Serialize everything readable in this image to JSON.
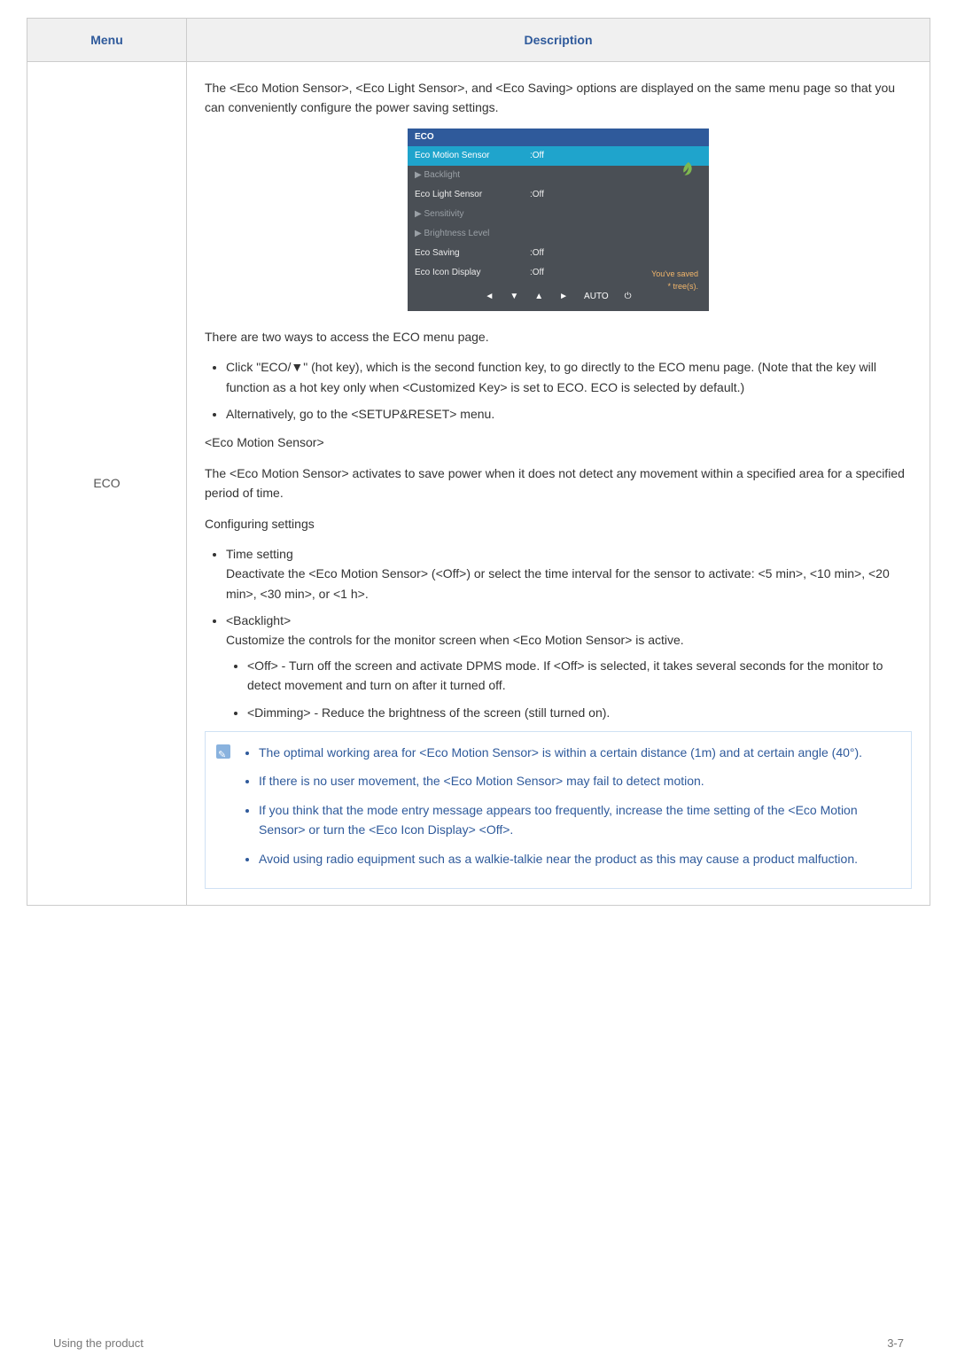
{
  "headers": {
    "menu": "Menu",
    "description": "Description"
  },
  "row_label": "ECO",
  "intro": "The <Eco Motion Sensor>, <Eco Light Sensor>, and <Eco Saving> options are displayed on the same menu page so that you can conveniently configure the power saving settings.",
  "osd": {
    "title": "ECO",
    "items": [
      {
        "label": "Eco Motion Sensor",
        "value": ":Off",
        "state": "selected"
      },
      {
        "label": "▶ Backlight",
        "value": "",
        "state": "dim"
      },
      {
        "label": "Eco Light Sensor",
        "value": ":Off",
        "state": "normal"
      },
      {
        "label": "▶ Sensitivity",
        "value": "",
        "state": "dim"
      },
      {
        "label": "▶ Brightness Level",
        "value": "",
        "state": "dim"
      },
      {
        "label": "Eco Saving",
        "value": ":Off",
        "state": "normal"
      },
      {
        "label": "Eco Icon Display",
        "value": ":Off",
        "state": "normal"
      }
    ],
    "badge_line1": "You've saved",
    "badge_line2": "* tree(s).",
    "nav": [
      "◄",
      "▼",
      "▲",
      "►",
      "AUTO",
      "⏻"
    ]
  },
  "access_intro": "There are two ways to access the ECO menu page.",
  "access_list": [
    "Click \"ECO/▼\" (hot key), which is the second function key, to go directly to the ECO menu page. (Note that the key will function as a hot key only when <Customized Key> is set to ECO. ECO is selected by default.)",
    "Alternatively, go to the <SETUP&RESET> menu."
  ],
  "section1_title": "<Eco Motion Sensor>",
  "section1_body": "The <Eco Motion Sensor> activates to save power when it does not detect any movement within a specified area for a specified period of time.",
  "config_title": "Configuring settings",
  "config_list": [
    {
      "head": "Time setting",
      "body": "Deactivate the <Eco Motion Sensor> (<Off>) or select the time interval for the sensor to activate: <5 min>, <10 min>, <20 min>, <30 min>, or <1 h>."
    },
    {
      "head": "<Backlight>",
      "body": "Customize the controls for the monitor screen when <Eco Motion Sensor> is active.",
      "sub": [
        "<Off> - Turn off the screen and activate DPMS mode. If <Off> is selected, it takes several seconds for the monitor to detect movement and turn on after it turned off.",
        "<Dimming> - Reduce the brightness of the screen (still turned on)."
      ]
    }
  ],
  "notes": [
    "The optimal working area for <Eco Motion Sensor> is within a certain distance (1m) and at certain angle (40°).",
    "If there is no user movement, the <Eco Motion Sensor> may fail to detect motion.",
    "If you think that the mode entry message appears too frequently, increase the time setting of the <Eco Motion Sensor> or turn the <Eco Icon Display> <Off>.",
    "Avoid using radio equipment such as a walkie-talkie near the product as this may cause a product malfuction."
  ],
  "footer": {
    "left": "Using the product",
    "right": "3-7"
  }
}
